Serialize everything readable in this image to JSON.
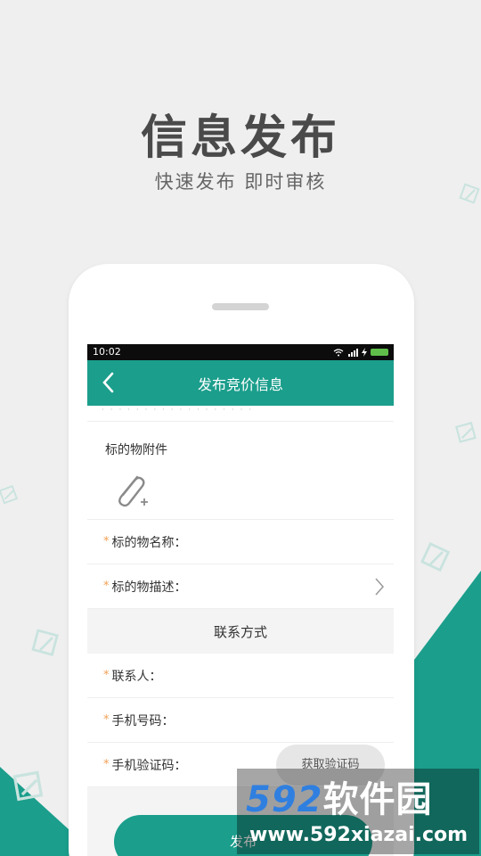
{
  "promo": {
    "headline": "信息发布",
    "subline": "快速发布  即时审核"
  },
  "statusbar": {
    "time": "10:02"
  },
  "header": {
    "title": "发布竞价信息"
  },
  "form": {
    "attachment_label": "标的物附件",
    "rows": [
      {
        "required_mark": "*",
        "label": "标的物名称："
      },
      {
        "required_mark": "*",
        "label": "标的物描述："
      }
    ],
    "contact_section_title": "联系方式",
    "contact_rows": [
      {
        "required_mark": "*",
        "label": "联系人："
      },
      {
        "required_mark": "*",
        "label": "手机号码："
      },
      {
        "required_mark": "*",
        "label": "手机验证码："
      }
    ],
    "get_code_button": "获取验证码",
    "submit_button": "发布"
  },
  "watermark": {
    "logo_digits": "592",
    "logo_text": "软件园",
    "url": "www.592xiazai.com"
  },
  "colors": {
    "accent": "#1b9e8c",
    "required": "#f0a155",
    "background": "#efefef"
  }
}
